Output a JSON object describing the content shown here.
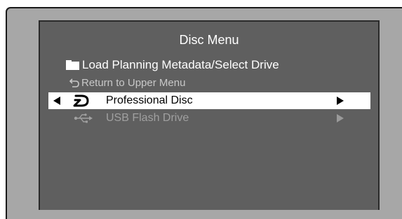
{
  "menu": {
    "title": "Disc Menu",
    "subtitle": "Load Planning Metadata/Select Drive",
    "subtitle_icon": "folder-icon",
    "return_item": {
      "label": "Return to Upper Menu",
      "icon": "return-arrow-icon",
      "enabled": false
    },
    "items": [
      {
        "label": "Professional Disc",
        "icon": "professional-disc-icon",
        "selected": true,
        "enabled": true
      },
      {
        "label": "USB Flash Drive",
        "icon": "usb-icon",
        "selected": false,
        "enabled": false
      }
    ]
  },
  "colors": {
    "bezel": "#a7a7a7",
    "screen_background": "#5f5f5f",
    "highlight": "#ffffff",
    "text": "#ffffff",
    "disabled_text": "#a0a0a0"
  }
}
